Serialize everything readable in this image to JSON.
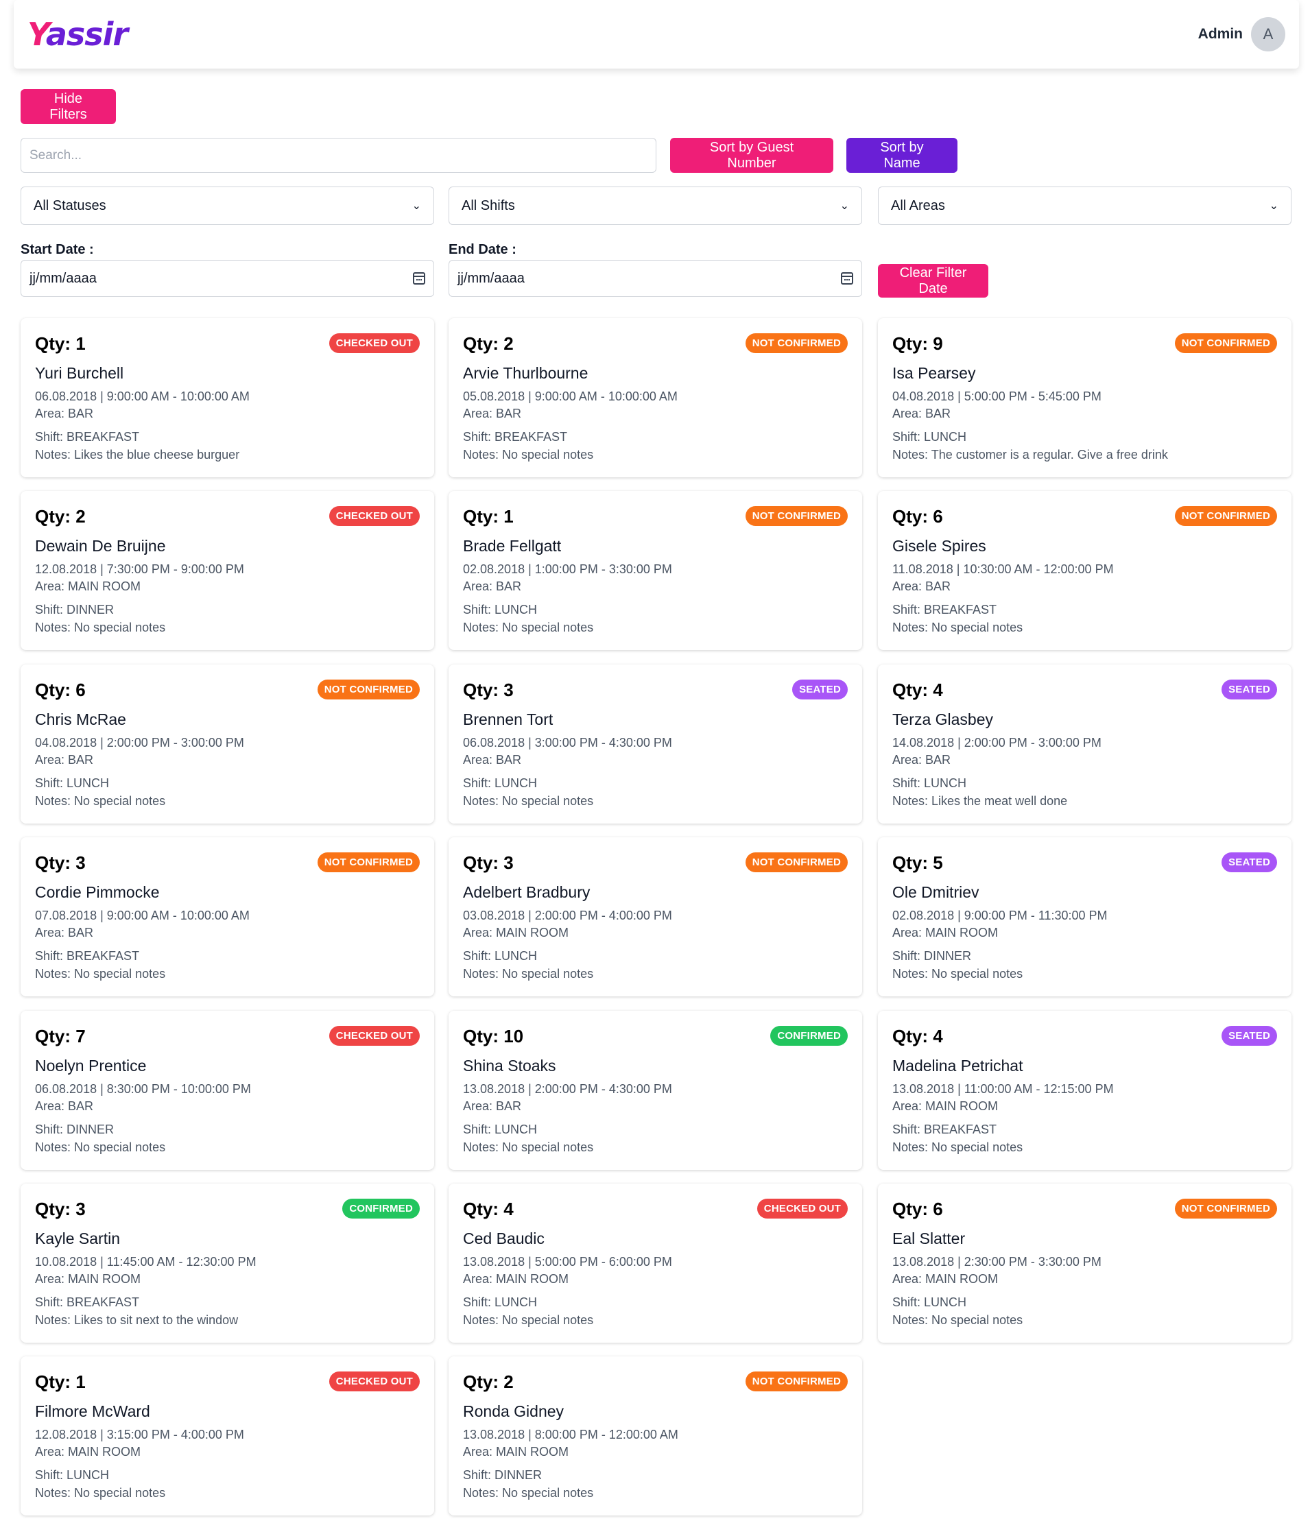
{
  "header": {
    "logo_first": "Y",
    "logo_rest": "assir",
    "user_name": "Admin",
    "avatar_initial": "A"
  },
  "filters": {
    "hide_filters_label": "Hide Filters",
    "search_placeholder": "Search...",
    "sort_guest_label": "Sort by Guest Number",
    "sort_name_label": "Sort by Name",
    "status_select": "All Statuses",
    "shift_select": "All Shifts",
    "area_select": "All Areas",
    "start_date_label": "Start Date :",
    "end_date_label": "End Date :",
    "start_date_value": "jj/mm/aaaa",
    "end_date_value": "jj/mm/aaaa",
    "clear_date_label": "Clear Filter Date"
  },
  "colors": {
    "pink": "#ef1e77",
    "purple": "#6a1fd6",
    "checked_out": "#ef4444",
    "not_confirmed": "#f97316",
    "seated": "#a855f7",
    "confirmed": "#22c55e"
  },
  "reservations": [
    {
      "qty": "Qty: 1",
      "name": "Yuri Burchell",
      "datetime": "06.08.2018 | 9:00:00 AM - 10:00:00 AM",
      "area": "Area: BAR",
      "shift": "Shift: BREAKFAST",
      "notes": "Notes: Likes the blue cheese burguer",
      "status": "CHECKED OUT"
    },
    {
      "qty": "Qty: 2",
      "name": "Arvie Thurlbourne",
      "datetime": "05.08.2018 | 9:00:00 AM - 10:00:00 AM",
      "area": "Area: BAR",
      "shift": "Shift: BREAKFAST",
      "notes": "Notes: No special notes",
      "status": "NOT CONFIRMED"
    },
    {
      "qty": "Qty: 9",
      "name": "Isa Pearsey",
      "datetime": "04.08.2018 | 5:00:00 PM - 5:45:00 PM",
      "area": "Area: BAR",
      "shift": "Shift: LUNCH",
      "notes": "Notes: The customer is a regular. Give a free drink",
      "status": "NOT CONFIRMED"
    },
    {
      "qty": "Qty: 2",
      "name": "Dewain De Bruijne",
      "datetime": "12.08.2018 | 7:30:00 PM - 9:00:00 PM",
      "area": "Area: MAIN ROOM",
      "shift": "Shift: DINNER",
      "notes": "Notes: No special notes",
      "status": "CHECKED OUT"
    },
    {
      "qty": "Qty: 1",
      "name": "Brade Fellgatt",
      "datetime": "02.08.2018 | 1:00:00 PM - 3:30:00 PM",
      "area": "Area: BAR",
      "shift": "Shift: LUNCH",
      "notes": "Notes: No special notes",
      "status": "NOT CONFIRMED"
    },
    {
      "qty": "Qty: 6",
      "name": "Gisele Spires",
      "datetime": "11.08.2018 | 10:30:00 AM - 12:00:00 PM",
      "area": "Area: BAR",
      "shift": "Shift: BREAKFAST",
      "notes": "Notes: No special notes",
      "status": "NOT CONFIRMED"
    },
    {
      "qty": "Qty: 6",
      "name": "Chris McRae",
      "datetime": "04.08.2018 | 2:00:00 PM - 3:00:00 PM",
      "area": "Area: BAR",
      "shift": "Shift: LUNCH",
      "notes": "Notes: No special notes",
      "status": "NOT CONFIRMED"
    },
    {
      "qty": "Qty: 3",
      "name": "Brennen Tort",
      "datetime": "06.08.2018 | 3:00:00 PM - 4:30:00 PM",
      "area": "Area: BAR",
      "shift": "Shift: LUNCH",
      "notes": "Notes: No special notes",
      "status": "SEATED"
    },
    {
      "qty": "Qty: 4",
      "name": "Terza Glasbey",
      "datetime": "14.08.2018 | 2:00:00 PM - 3:00:00 PM",
      "area": "Area: BAR",
      "shift": "Shift: LUNCH",
      "notes": "Notes: Likes the meat well done",
      "status": "SEATED"
    },
    {
      "qty": "Qty: 3",
      "name": "Cordie Pimmocke",
      "datetime": "07.08.2018 | 9:00:00 AM - 10:00:00 AM",
      "area": "Area: BAR",
      "shift": "Shift: BREAKFAST",
      "notes": "Notes: No special notes",
      "status": "NOT CONFIRMED"
    },
    {
      "qty": "Qty: 3",
      "name": "Adelbert Bradbury",
      "datetime": "03.08.2018 | 2:00:00 PM - 4:00:00 PM",
      "area": "Area: MAIN ROOM",
      "shift": "Shift: LUNCH",
      "notes": "Notes: No special notes",
      "status": "NOT CONFIRMED"
    },
    {
      "qty": "Qty: 5",
      "name": "Ole Dmitriev",
      "datetime": "02.08.2018 | 9:00:00 PM - 11:30:00 PM",
      "area": "Area: MAIN ROOM",
      "shift": "Shift: DINNER",
      "notes": "Notes: No special notes",
      "status": "SEATED"
    },
    {
      "qty": "Qty: 7",
      "name": "Noelyn Prentice",
      "datetime": "06.08.2018 | 8:30:00 PM - 10:00:00 PM",
      "area": "Area: BAR",
      "shift": "Shift: DINNER",
      "notes": "Notes: No special notes",
      "status": "CHECKED OUT"
    },
    {
      "qty": "Qty: 10",
      "name": "Shina Stoaks",
      "datetime": "13.08.2018 | 2:00:00 PM - 4:30:00 PM",
      "area": "Area: BAR",
      "shift": "Shift: LUNCH",
      "notes": "Notes: No special notes",
      "status": "CONFIRMED"
    },
    {
      "qty": "Qty: 4",
      "name": "Madelina Petrichat",
      "datetime": "13.08.2018 | 11:00:00 AM - 12:15:00 PM",
      "area": "Area: MAIN ROOM",
      "shift": "Shift: BREAKFAST",
      "notes": "Notes: No special notes",
      "status": "SEATED"
    },
    {
      "qty": "Qty: 3",
      "name": "Kayle Sartin",
      "datetime": "10.08.2018 | 11:45:00 AM - 12:30:00 PM",
      "area": "Area: MAIN ROOM",
      "shift": "Shift: BREAKFAST",
      "notes": "Notes: Likes to sit next to the window",
      "status": "CONFIRMED"
    },
    {
      "qty": "Qty: 4",
      "name": "Ced Baudic",
      "datetime": "13.08.2018 | 5:00:00 PM - 6:00:00 PM",
      "area": "Area: MAIN ROOM",
      "shift": "Shift: LUNCH",
      "notes": "Notes: No special notes",
      "status": "CHECKED OUT"
    },
    {
      "qty": "Qty: 6",
      "name": "Eal Slatter",
      "datetime": "13.08.2018 | 2:30:00 PM - 3:30:00 PM",
      "area": "Area: MAIN ROOM",
      "shift": "Shift: LUNCH",
      "notes": "Notes: No special notes",
      "status": "NOT CONFIRMED"
    },
    {
      "qty": "Qty: 1",
      "name": "Filmore McWard",
      "datetime": "12.08.2018 | 3:15:00 PM - 4:00:00 PM",
      "area": "Area: MAIN ROOM",
      "shift": "Shift: LUNCH",
      "notes": "Notes: No special notes",
      "status": "CHECKED OUT"
    },
    {
      "qty": "Qty: 2",
      "name": "Ronda Gidney",
      "datetime": "13.08.2018 | 8:00:00 PM - 12:00:00 AM",
      "area": "Area: MAIN ROOM",
      "shift": "Shift: DINNER",
      "notes": "Notes: No special notes",
      "status": "NOT CONFIRMED"
    }
  ]
}
